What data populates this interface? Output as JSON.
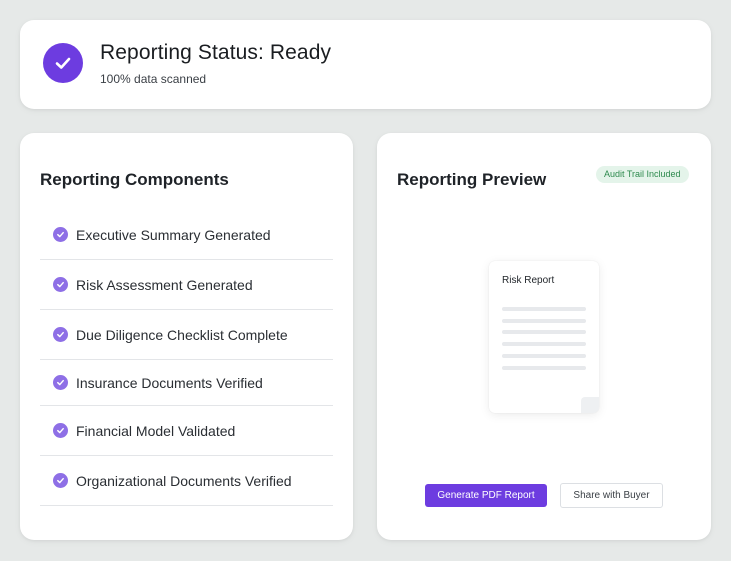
{
  "status": {
    "title": "Reporting Status: Ready",
    "subtitle": "100% data scanned",
    "icon": "check-circle-icon",
    "accent": "#6d3ce0"
  },
  "components": {
    "title": "Reporting Components",
    "items": [
      {
        "label": "Executive Summary Generated",
        "icon": "check-circle-icon"
      },
      {
        "label": "Risk Assessment Generated",
        "icon": "check-circle-icon"
      },
      {
        "label": "Due Diligence Checklist Complete",
        "icon": "check-circle-icon"
      },
      {
        "label": "Insurance Documents Verified",
        "icon": "check-circle-icon"
      },
      {
        "label": "Financial Model Validated",
        "icon": "check-circle-icon"
      },
      {
        "label": "Organizational Documents Verified",
        "icon": "check-circle-icon"
      }
    ]
  },
  "preview": {
    "title": "Reporting Preview",
    "badge": "Audit Trail Included",
    "badge_color": "#2e8a4e",
    "document": {
      "title": "Risk Report",
      "icon": "document-icon"
    },
    "primary_button": "Generate PDF Report",
    "secondary_button": "Share with Buyer"
  }
}
